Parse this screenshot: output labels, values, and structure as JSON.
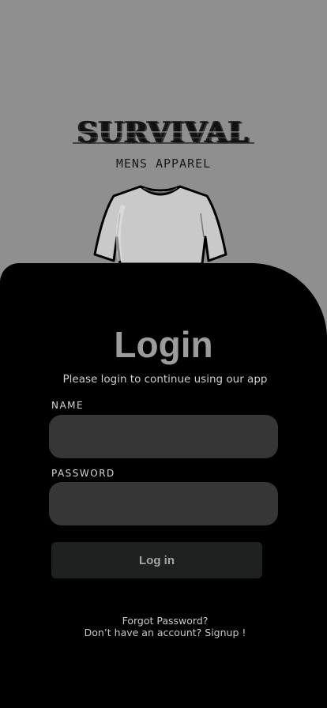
{
  "brand": {
    "name": "SURVIVAL",
    "tagline": "MENS APPAREL",
    "logo_icon": "t-shirt-icon"
  },
  "login": {
    "title": "Login",
    "subtitle": "Please login to continue using our app",
    "name_label": "NAME",
    "name_value": "",
    "password_label": "PASSWORD",
    "password_value": "",
    "button_label": "Log in",
    "forgot_link": "Forgot Password?",
    "signup_link": "Don’t have an account? Signup !"
  },
  "colors": {
    "background": "#8f8f8f",
    "panel": "#000000",
    "input": "#363636",
    "button": "#1f2121"
  }
}
